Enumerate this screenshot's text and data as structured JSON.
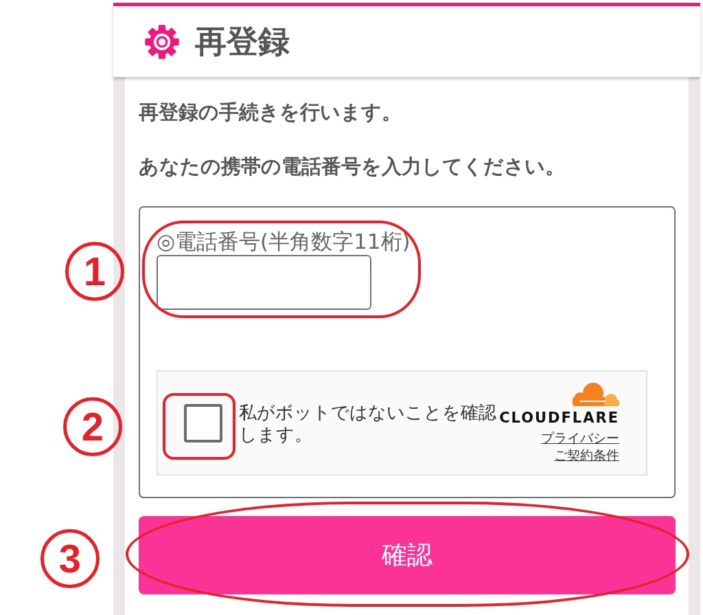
{
  "header": {
    "title": "再登録"
  },
  "intro": [
    "再登録の手続きを行います。",
    "あなたの携帯の電話番号を入力してください。"
  ],
  "form": {
    "phone_field": {
      "label": "◎電話番号(半角数字11桁)",
      "annotation": "1"
    },
    "captcha": {
      "checked": false,
      "text": "私がボットではないことを確認します。",
      "brand": "CLOUDFLARE",
      "links": [
        "プライバシー",
        "ご契約条件"
      ],
      "annotation": "2"
    }
  },
  "submit_button": {
    "label": "確認",
    "annotation": "3"
  }
}
